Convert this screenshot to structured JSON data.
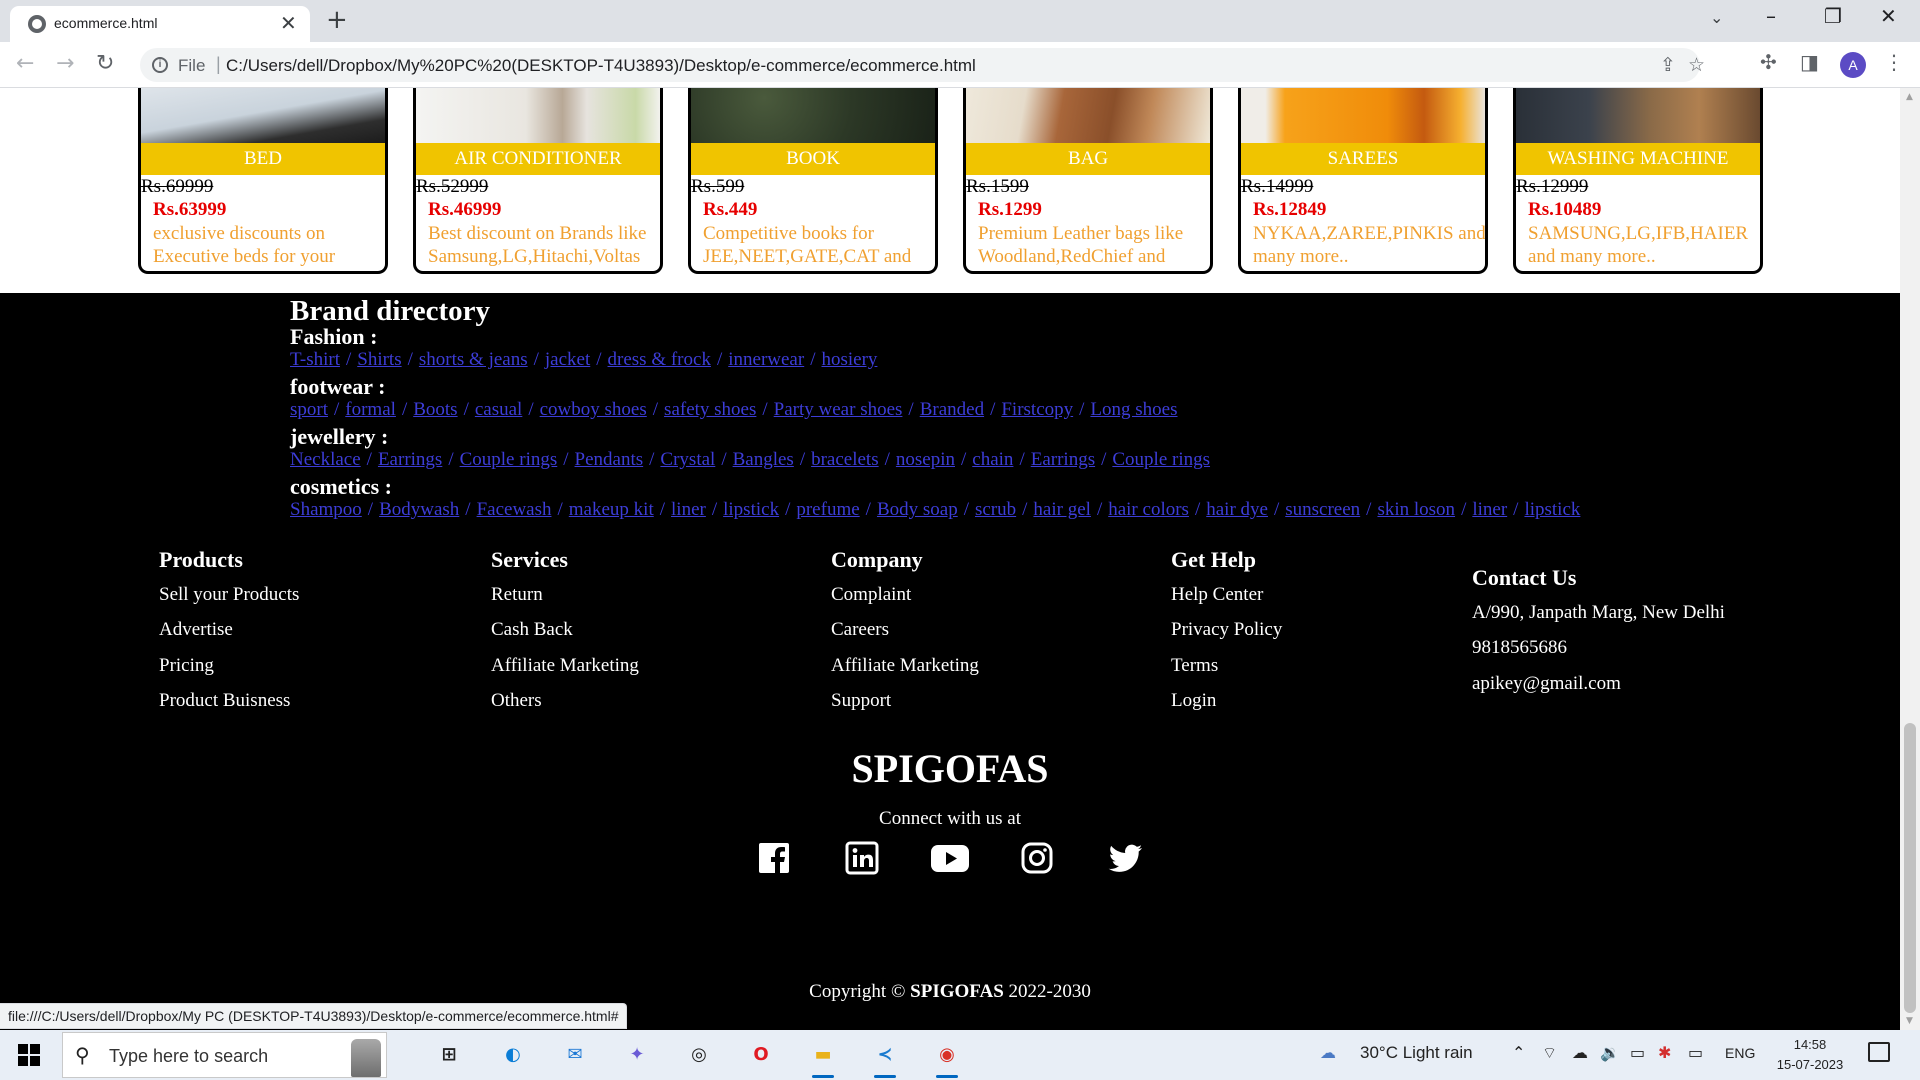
{
  "browser": {
    "tab_title": "ecommerce.html",
    "omni_label": "File",
    "url": "C:/Users/dell/Dropbox/My%20PC%20(DESKTOP-T4U3893)/Desktop/e-commerce/ecommerce.html",
    "profile_initial": "A",
    "status_url": "file:///C:/Users/dell/Dropbox/My PC (DESKTOP-T4U3893)/Desktop/e-commerce/ecommerce.html#"
  },
  "products": [
    {
      "name": "BED",
      "old_price": "Rs.69999",
      "new_price": "Rs.63999",
      "desc": "exclusive discounts on Executive beds for your"
    },
    {
      "name": "AIR CONDITIONER",
      "old_price": "Rs.52999",
      "new_price": "Rs.46999",
      "desc": "Best discount on Brands like Samsung,LG,Hitachi,Voltas"
    },
    {
      "name": "BOOK",
      "old_price": "Rs.599",
      "new_price": "Rs.449",
      "desc": "Competitive books for JEE,NEET,GATE,CAT and"
    },
    {
      "name": "BAG",
      "old_price": "Rs.1599",
      "new_price": "Rs.1299",
      "desc": "Premium Leather bags like Woodland,RedChief and"
    },
    {
      "name": "SAREES",
      "old_price": "Rs.14999",
      "new_price": "Rs.12849",
      "desc": "NYKAA,ZAREE,PINKIS and many more.."
    },
    {
      "name": "WASHING MACHINE",
      "old_price": "Rs.12999",
      "new_price": "Rs.10489",
      "desc": "SAMSUNG,LG,IFB,HAIER and many more.."
    }
  ],
  "brand_directory": {
    "title": "Brand directory",
    "categories": [
      {
        "label": "Fashion :",
        "links": [
          "T-shirt",
          "Shirts",
          "shorts & jeans",
          "jacket",
          "dress & frock",
          "innerwear",
          "hosiery"
        ]
      },
      {
        "label": "footwear :",
        "links": [
          "sport",
          "formal",
          "Boots",
          "casual",
          "cowboy shoes",
          "safety shoes",
          "Party wear shoes",
          "Branded",
          "Firstcopy",
          "Long shoes"
        ]
      },
      {
        "label": "jewellery :",
        "links": [
          "Necklace",
          "Earrings",
          "Couple rings",
          "Pendants",
          "Crystal",
          "Bangles",
          "bracelets",
          "nosepin",
          "chain",
          "Earrings",
          "Couple rings"
        ]
      },
      {
        "label": "cosmetics :",
        "links": [
          "Shampoo",
          "Bodywash",
          "Facewash",
          "makeup kit",
          "liner",
          "lipstick",
          "prefume",
          "Body soap",
          "scrub",
          "hair gel",
          "hair colors",
          "hair dye",
          "sunscreen",
          "skin loson",
          "liner",
          "lipstick"
        ]
      }
    ]
  },
  "footer_columns": [
    {
      "heading": "Products",
      "items": [
        "Sell your Products",
        "Advertise",
        "Pricing",
        "Product Buisness"
      ]
    },
    {
      "heading": "Services",
      "items": [
        "Return",
        "Cash Back",
        "Affiliate Marketing",
        "Others"
      ]
    },
    {
      "heading": "Company",
      "items": [
        "Complaint",
        "Careers",
        "Affiliate Marketing",
        "Support"
      ]
    },
    {
      "heading": "Get Help",
      "items": [
        "Help Center",
        "Privacy Policy",
        "Terms",
        "Login"
      ]
    }
  ],
  "contact": {
    "heading": "Contact Us",
    "address": "A/990, Janpath Marg, New Delhi",
    "phone": "9818565686",
    "email": "apikey@gmail.com"
  },
  "brand_name": "SPIGOFAS",
  "connect_text": "Connect with us at",
  "social_icons": [
    "facebook-icon",
    "linkedin-icon",
    "youtube-icon",
    "instagram-icon",
    "twitter-icon"
  ],
  "copyright": {
    "prefix": "Copyright ©",
    "brand": "SPIGOFAS",
    "years": "2022-2030"
  },
  "taskbar": {
    "search_placeholder": "Type here to search",
    "weather": "30°C  Light rain",
    "language": "ENG",
    "time": "14:58",
    "date": "15-07-2023"
  },
  "colors": {
    "card_label_bg": "#f0c400",
    "new_price": "#e60000",
    "description": "#f0a030",
    "link": "#3d3dd8",
    "footer_bg": "#000000"
  }
}
